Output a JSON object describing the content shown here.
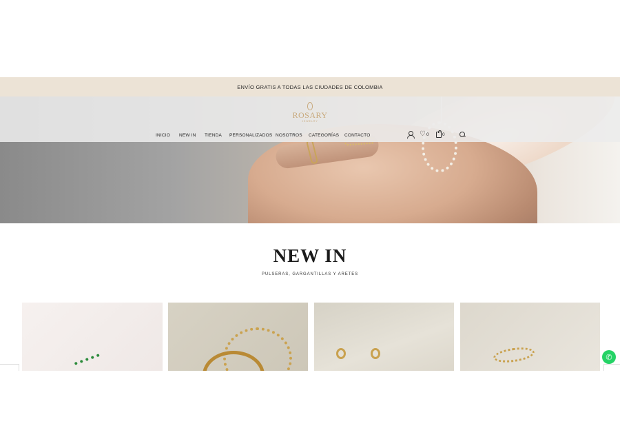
{
  "announcement": {
    "text": "ENVÍO GRATIS A TODAS LAS CIUDADES DE COLOMBIA"
  },
  "brand": {
    "name": "ROSARY",
    "tagline": "JEWELRY"
  },
  "nav": {
    "items": [
      {
        "label": "INICIO"
      },
      {
        "label": "NEW IN"
      },
      {
        "label": "TIENDA"
      },
      {
        "label": "PERSONALIZADOS"
      },
      {
        "label": "NOSOTROS"
      },
      {
        "label": "CATEGORÍAS"
      },
      {
        "label": "CONTACTO"
      }
    ]
  },
  "header_icons": {
    "account": "user-icon",
    "wishlist": "heart-icon",
    "wishlist_count": "0",
    "cart": "bag-icon",
    "cart_count": "0",
    "search": "search-icon"
  },
  "section": {
    "title": "NEW IN",
    "subtitle": "PULSERAS, GARGANTILLAS Y ARETES"
  },
  "products": [
    {
      "image": "green-star-earring"
    },
    {
      "image": "gold-rings"
    },
    {
      "image": "gold-hoop-earrings"
    },
    {
      "image": "gold-ring-set"
    }
  ],
  "colors": {
    "announcement_bg": "#ece3d6",
    "brand_gold": "#c8a97c",
    "whatsapp_green": "#25d366"
  },
  "floating": {
    "whatsapp": "whatsapp-icon"
  }
}
